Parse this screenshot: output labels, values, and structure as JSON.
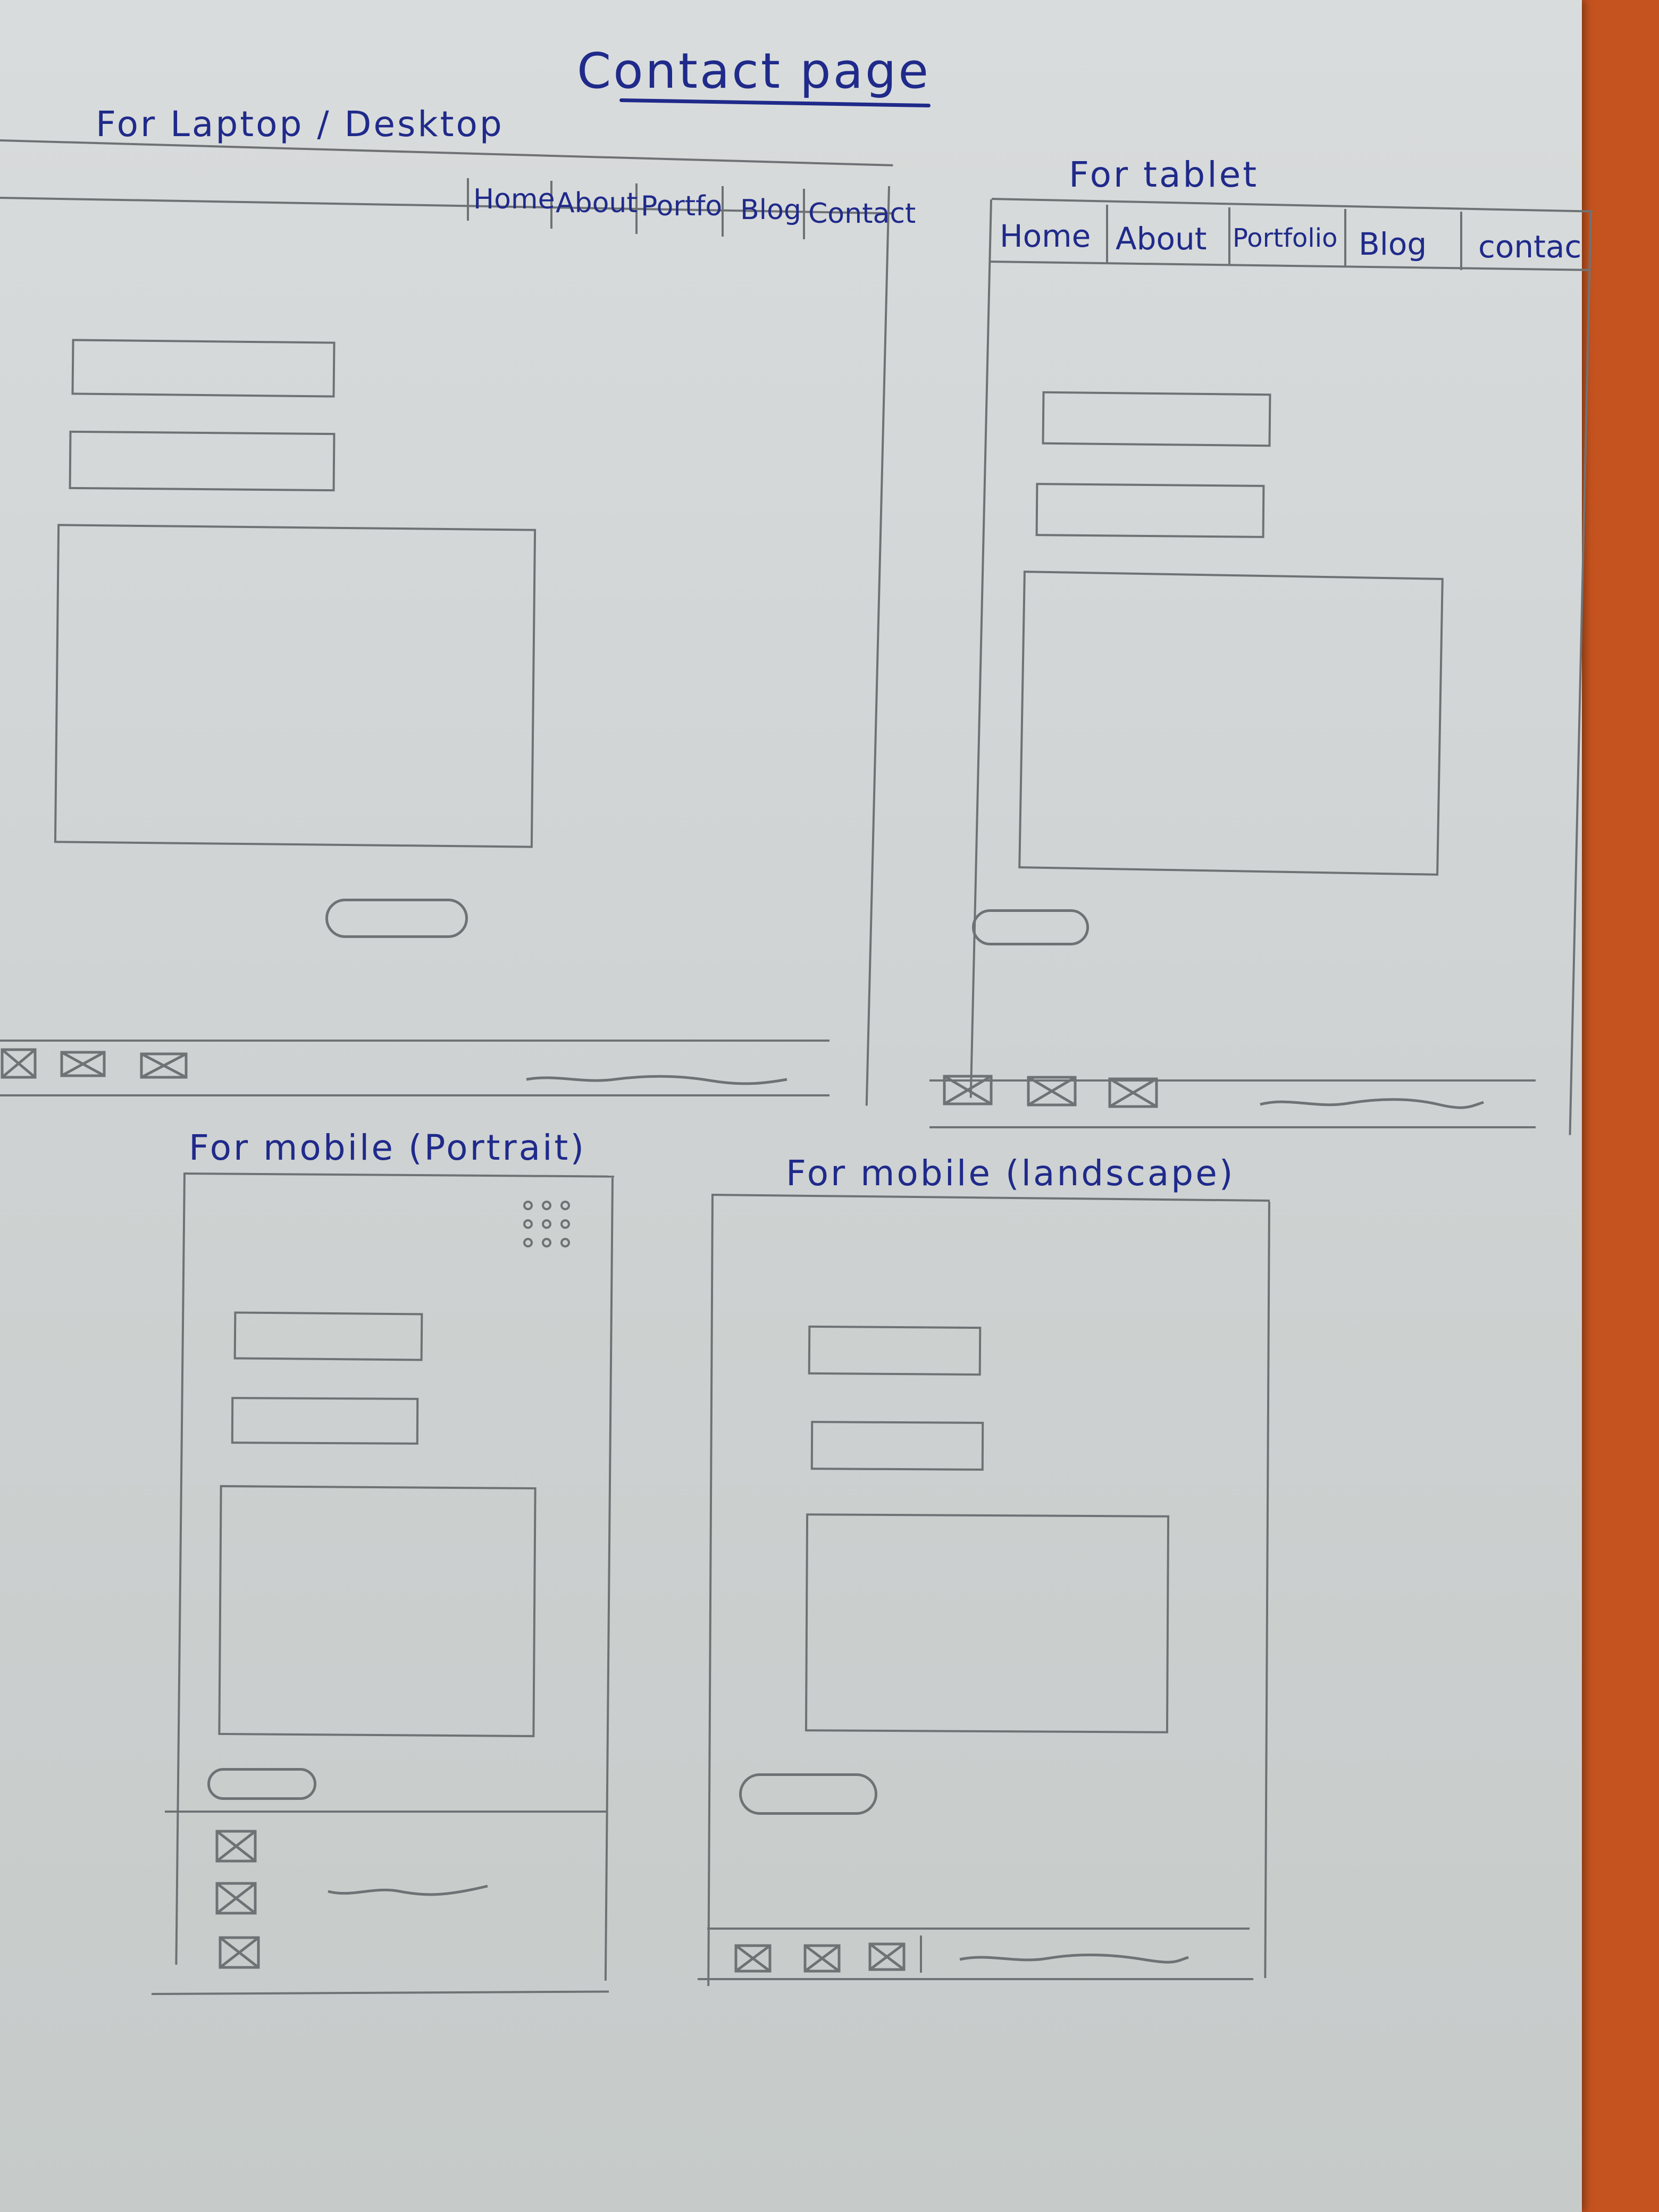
{
  "page_title": "Contact page",
  "frames": {
    "desktop": {
      "label": "For Laptop / Desktop",
      "nav": [
        "Home",
        "About",
        "Portfo",
        "Blog",
        "Contact"
      ]
    },
    "tablet": {
      "label": "For tablet",
      "nav": [
        "Home",
        "About",
        "Portfolio",
        "Blog",
        "contac"
      ]
    },
    "mobile_portrait": {
      "label": "For mobile (Portrait)"
    },
    "mobile_landscape": {
      "label": "For mobile (landscape)"
    }
  },
  "icons": {
    "placeholder": "image-placeholder-icon",
    "menu": "grid-menu-icon"
  },
  "colors": {
    "ink": "#1f2a8a",
    "pencil": "#6f7274",
    "paper": "#d4d7d7",
    "table": "#c5531f"
  }
}
